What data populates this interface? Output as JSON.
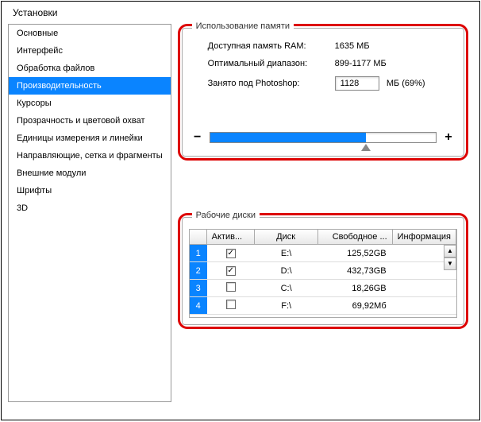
{
  "title": "Установки",
  "sidebar": {
    "items": [
      {
        "label": "Основные"
      },
      {
        "label": "Интерфейс"
      },
      {
        "label": "Обработка файлов"
      },
      {
        "label": "Производительность"
      },
      {
        "label": "Курсоры"
      },
      {
        "label": "Прозрачность и цветовой охват"
      },
      {
        "label": "Единицы измерения и линейки"
      },
      {
        "label": "Направляющие, сетка и фрагменты"
      },
      {
        "label": "Внешние модули"
      },
      {
        "label": "Шрифты"
      },
      {
        "label": "3D"
      }
    ],
    "selected_index": 3
  },
  "memory": {
    "legend": "Использование памяти",
    "available_label": "Доступная память RAM:",
    "available_value": "1635 МБ",
    "optimal_label": "Оптимальный диапазон:",
    "optimal_value": "899-1177 МБ",
    "used_label": "Занято под Photoshop:",
    "used_value": "1128",
    "used_suffix": "МБ (69%)",
    "slider_percent": 69,
    "minus": "−",
    "plus": "+"
  },
  "disks": {
    "legend": "Рабочие диски",
    "headers": {
      "active": "Актив...",
      "disk": "Диск",
      "free": "Свободное ...",
      "info": "Информация"
    },
    "rows": [
      {
        "num": "1",
        "active": true,
        "disk": "E:\\",
        "free": "125,52GB",
        "info": ""
      },
      {
        "num": "2",
        "active": true,
        "disk": "D:\\",
        "free": "432,73GB",
        "info": ""
      },
      {
        "num": "3",
        "active": false,
        "disk": "C:\\",
        "free": "18,26GB",
        "info": ""
      },
      {
        "num": "4",
        "active": false,
        "disk": "F:\\",
        "free": "69,92Мб",
        "info": ""
      }
    ],
    "check_glyph": "✓",
    "up": "▲",
    "down": "▼"
  }
}
